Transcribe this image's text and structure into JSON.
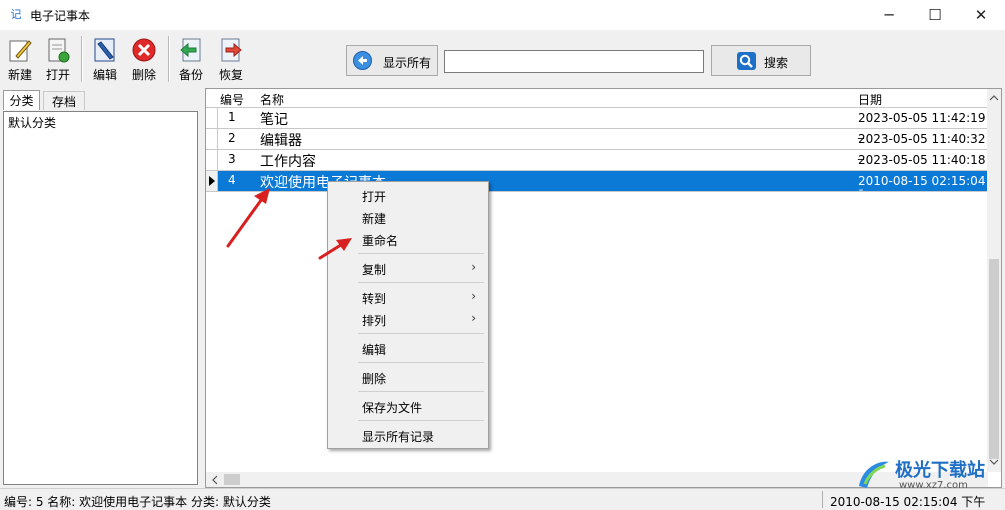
{
  "window": {
    "title": "电子记事本",
    "app_icon_glyph": "记",
    "controls": [
      "─",
      "☐",
      "✕"
    ]
  },
  "toolbar": {
    "new": "新建",
    "open": "打开",
    "edit": "编辑",
    "delete": "删除",
    "backup": "备份",
    "restore": "恢复",
    "show_all": "显示所有",
    "search_value": "",
    "search_button": "搜索"
  },
  "sidebar": {
    "tabs": [
      "分类",
      "存档"
    ],
    "active_tab": "分类",
    "items": [
      "默认分类"
    ]
  },
  "grid": {
    "columns": [
      "编号",
      "名称",
      "日期"
    ],
    "rows": [
      {
        "num": "1",
        "name": "笔记",
        "date": "2023-05-05 11:42:19 _"
      },
      {
        "num": "2",
        "name": "编辑器",
        "date": "2023-05-05 11:40:32 _"
      },
      {
        "num": "3",
        "name": "工作内容",
        "date": "2023-05-05 11:40:18 _"
      },
      {
        "num": "4",
        "name": "欢迎使用电子记事本",
        "date": "2010-08-15 02:15:04 ¯",
        "selected": true
      }
    ]
  },
  "context_menu": {
    "items": [
      {
        "label": "打开"
      },
      {
        "label": "新建"
      },
      {
        "label": "重命名"
      },
      {
        "label": "复制",
        "submenu": true
      },
      {
        "label": "转到",
        "submenu": true
      },
      {
        "label": "排列",
        "submenu": true
      },
      {
        "label": "编辑"
      },
      {
        "label": "删除"
      },
      {
        "label": "保存为文件"
      },
      {
        "label": "显示所有记录"
      }
    ],
    "submenu_glyph": "›"
  },
  "status_bar": {
    "left": "编号: 5   名称: 欢迎使用电子记事本   分类: 默认分类",
    "right": "2010-08-15 02:15:04 下午"
  },
  "watermark": {
    "text": "极光下载站",
    "url": "www.xz7.com"
  },
  "colors": {
    "selection": "#0b7ad7",
    "arrow_annotation": "#d92020",
    "delete_icon": "#e02a2a"
  }
}
